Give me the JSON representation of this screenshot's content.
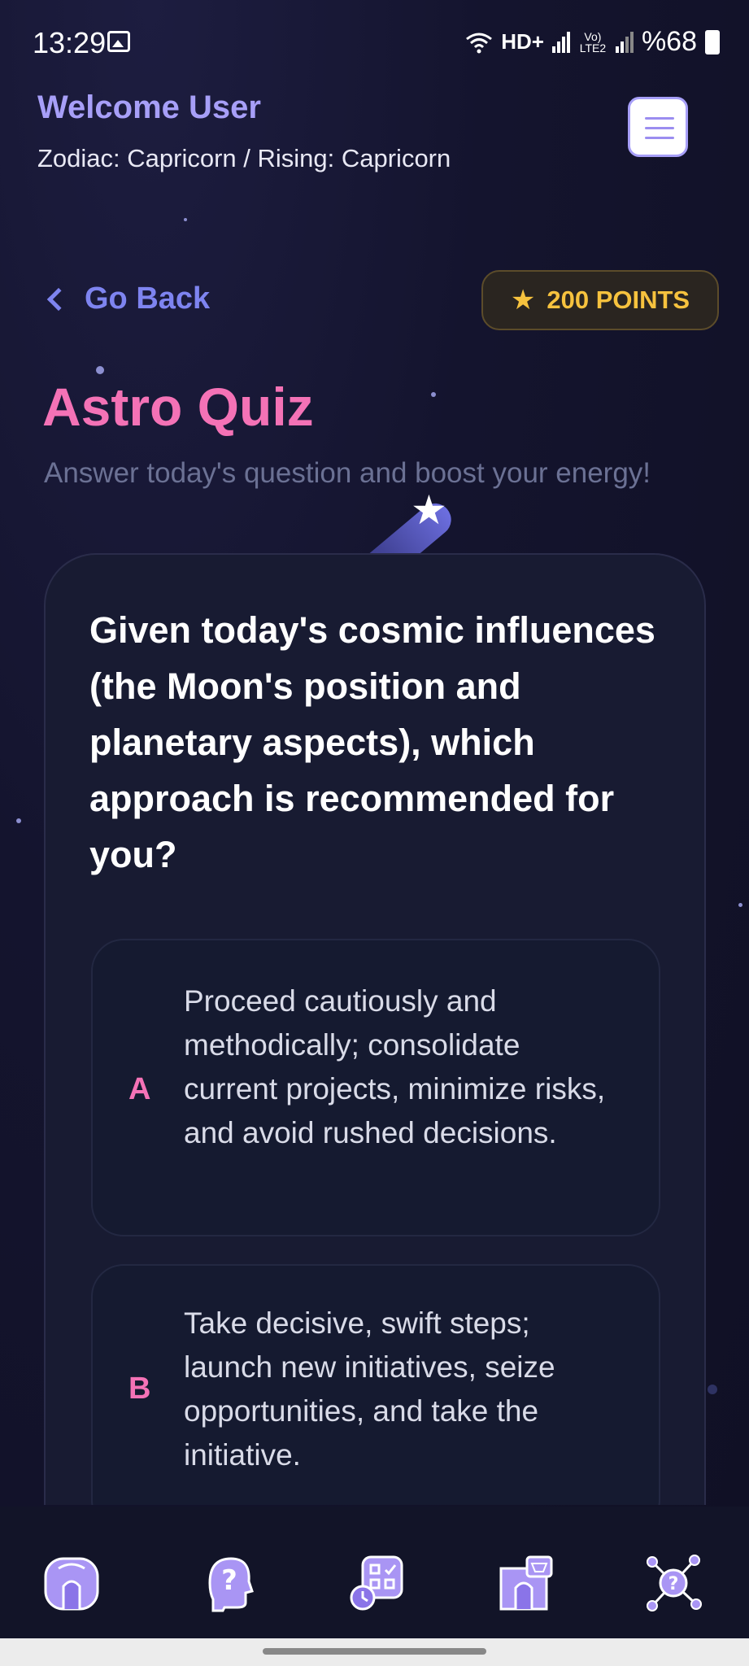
{
  "status_bar": {
    "time": "13:29",
    "network": "HD+",
    "lte": "Vo) LTE2",
    "battery": "%68"
  },
  "header": {
    "welcome": "Welcome User",
    "zodiac": "Zodiac: Capricorn / Rising: Capricorn",
    "menu_icon": "hamburger-menu-icon"
  },
  "nav": {
    "back_label": "Go Back",
    "points_label": "200 POINTS"
  },
  "page": {
    "title": "Astro Quiz",
    "subtitle": "Answer today's question and boost your energy!"
  },
  "quiz": {
    "question": "Given today's cosmic influences (the Moon's position and planetary aspects), which approach is recommended for you?",
    "options": [
      {
        "letter": "A",
        "text": "Proceed cautiously and methodically; consolidate current projects, minimize risks, and avoid rushed decisions."
      },
      {
        "letter": "B",
        "text": "Take decisive, swift steps; launch new initiatives, seize opportunities, and take the initiative."
      }
    ]
  },
  "bottom_nav": {
    "items": [
      "home-icon",
      "quiz-help-icon",
      "tasks-icon",
      "shop-icon",
      "network-icon"
    ]
  },
  "colors": {
    "accent_purple": "#a79ff8",
    "accent_pink": "#f472b6",
    "points_gold": "#f6c23e",
    "background": "#14142e"
  }
}
